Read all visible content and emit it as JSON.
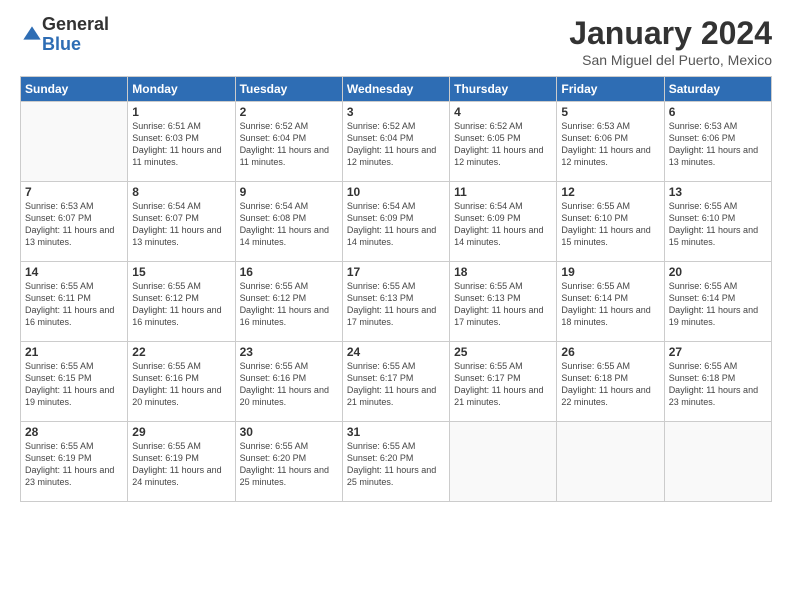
{
  "logo": {
    "general": "General",
    "blue": "Blue"
  },
  "header": {
    "month_title": "January 2024",
    "location": "San Miguel del Puerto, Mexico"
  },
  "columns": [
    "Sunday",
    "Monday",
    "Tuesday",
    "Wednesday",
    "Thursday",
    "Friday",
    "Saturday"
  ],
  "weeks": [
    [
      {
        "day": "",
        "sunrise": "",
        "sunset": "",
        "daylight": ""
      },
      {
        "day": "1",
        "sunrise": "Sunrise: 6:51 AM",
        "sunset": "Sunset: 6:03 PM",
        "daylight": "Daylight: 11 hours and 11 minutes."
      },
      {
        "day": "2",
        "sunrise": "Sunrise: 6:52 AM",
        "sunset": "Sunset: 6:04 PM",
        "daylight": "Daylight: 11 hours and 11 minutes."
      },
      {
        "day": "3",
        "sunrise": "Sunrise: 6:52 AM",
        "sunset": "Sunset: 6:04 PM",
        "daylight": "Daylight: 11 hours and 12 minutes."
      },
      {
        "day": "4",
        "sunrise": "Sunrise: 6:52 AM",
        "sunset": "Sunset: 6:05 PM",
        "daylight": "Daylight: 11 hours and 12 minutes."
      },
      {
        "day": "5",
        "sunrise": "Sunrise: 6:53 AM",
        "sunset": "Sunset: 6:06 PM",
        "daylight": "Daylight: 11 hours and 12 minutes."
      },
      {
        "day": "6",
        "sunrise": "Sunrise: 6:53 AM",
        "sunset": "Sunset: 6:06 PM",
        "daylight": "Daylight: 11 hours and 13 minutes."
      }
    ],
    [
      {
        "day": "7",
        "sunrise": "Sunrise: 6:53 AM",
        "sunset": "Sunset: 6:07 PM",
        "daylight": "Daylight: 11 hours and 13 minutes."
      },
      {
        "day": "8",
        "sunrise": "Sunrise: 6:54 AM",
        "sunset": "Sunset: 6:07 PM",
        "daylight": "Daylight: 11 hours and 13 minutes."
      },
      {
        "day": "9",
        "sunrise": "Sunrise: 6:54 AM",
        "sunset": "Sunset: 6:08 PM",
        "daylight": "Daylight: 11 hours and 14 minutes."
      },
      {
        "day": "10",
        "sunrise": "Sunrise: 6:54 AM",
        "sunset": "Sunset: 6:09 PM",
        "daylight": "Daylight: 11 hours and 14 minutes."
      },
      {
        "day": "11",
        "sunrise": "Sunrise: 6:54 AM",
        "sunset": "Sunset: 6:09 PM",
        "daylight": "Daylight: 11 hours and 14 minutes."
      },
      {
        "day": "12",
        "sunrise": "Sunrise: 6:55 AM",
        "sunset": "Sunset: 6:10 PM",
        "daylight": "Daylight: 11 hours and 15 minutes."
      },
      {
        "day": "13",
        "sunrise": "Sunrise: 6:55 AM",
        "sunset": "Sunset: 6:10 PM",
        "daylight": "Daylight: 11 hours and 15 minutes."
      }
    ],
    [
      {
        "day": "14",
        "sunrise": "Sunrise: 6:55 AM",
        "sunset": "Sunset: 6:11 PM",
        "daylight": "Daylight: 11 hours and 16 minutes."
      },
      {
        "day": "15",
        "sunrise": "Sunrise: 6:55 AM",
        "sunset": "Sunset: 6:12 PM",
        "daylight": "Daylight: 11 hours and 16 minutes."
      },
      {
        "day": "16",
        "sunrise": "Sunrise: 6:55 AM",
        "sunset": "Sunset: 6:12 PM",
        "daylight": "Daylight: 11 hours and 16 minutes."
      },
      {
        "day": "17",
        "sunrise": "Sunrise: 6:55 AM",
        "sunset": "Sunset: 6:13 PM",
        "daylight": "Daylight: 11 hours and 17 minutes."
      },
      {
        "day": "18",
        "sunrise": "Sunrise: 6:55 AM",
        "sunset": "Sunset: 6:13 PM",
        "daylight": "Daylight: 11 hours and 17 minutes."
      },
      {
        "day": "19",
        "sunrise": "Sunrise: 6:55 AM",
        "sunset": "Sunset: 6:14 PM",
        "daylight": "Daylight: 11 hours and 18 minutes."
      },
      {
        "day": "20",
        "sunrise": "Sunrise: 6:55 AM",
        "sunset": "Sunset: 6:14 PM",
        "daylight": "Daylight: 11 hours and 19 minutes."
      }
    ],
    [
      {
        "day": "21",
        "sunrise": "Sunrise: 6:55 AM",
        "sunset": "Sunset: 6:15 PM",
        "daylight": "Daylight: 11 hours and 19 minutes."
      },
      {
        "day": "22",
        "sunrise": "Sunrise: 6:55 AM",
        "sunset": "Sunset: 6:16 PM",
        "daylight": "Daylight: 11 hours and 20 minutes."
      },
      {
        "day": "23",
        "sunrise": "Sunrise: 6:55 AM",
        "sunset": "Sunset: 6:16 PM",
        "daylight": "Daylight: 11 hours and 20 minutes."
      },
      {
        "day": "24",
        "sunrise": "Sunrise: 6:55 AM",
        "sunset": "Sunset: 6:17 PM",
        "daylight": "Daylight: 11 hours and 21 minutes."
      },
      {
        "day": "25",
        "sunrise": "Sunrise: 6:55 AM",
        "sunset": "Sunset: 6:17 PM",
        "daylight": "Daylight: 11 hours and 21 minutes."
      },
      {
        "day": "26",
        "sunrise": "Sunrise: 6:55 AM",
        "sunset": "Sunset: 6:18 PM",
        "daylight": "Daylight: 11 hours and 22 minutes."
      },
      {
        "day": "27",
        "sunrise": "Sunrise: 6:55 AM",
        "sunset": "Sunset: 6:18 PM",
        "daylight": "Daylight: 11 hours and 23 minutes."
      }
    ],
    [
      {
        "day": "28",
        "sunrise": "Sunrise: 6:55 AM",
        "sunset": "Sunset: 6:19 PM",
        "daylight": "Daylight: 11 hours and 23 minutes."
      },
      {
        "day": "29",
        "sunrise": "Sunrise: 6:55 AM",
        "sunset": "Sunset: 6:19 PM",
        "daylight": "Daylight: 11 hours and 24 minutes."
      },
      {
        "day": "30",
        "sunrise": "Sunrise: 6:55 AM",
        "sunset": "Sunset: 6:20 PM",
        "daylight": "Daylight: 11 hours and 25 minutes."
      },
      {
        "day": "31",
        "sunrise": "Sunrise: 6:55 AM",
        "sunset": "Sunset: 6:20 PM",
        "daylight": "Daylight: 11 hours and 25 minutes."
      },
      {
        "day": "",
        "sunrise": "",
        "sunset": "",
        "daylight": ""
      },
      {
        "day": "",
        "sunrise": "",
        "sunset": "",
        "daylight": ""
      },
      {
        "day": "",
        "sunrise": "",
        "sunset": "",
        "daylight": ""
      }
    ]
  ]
}
